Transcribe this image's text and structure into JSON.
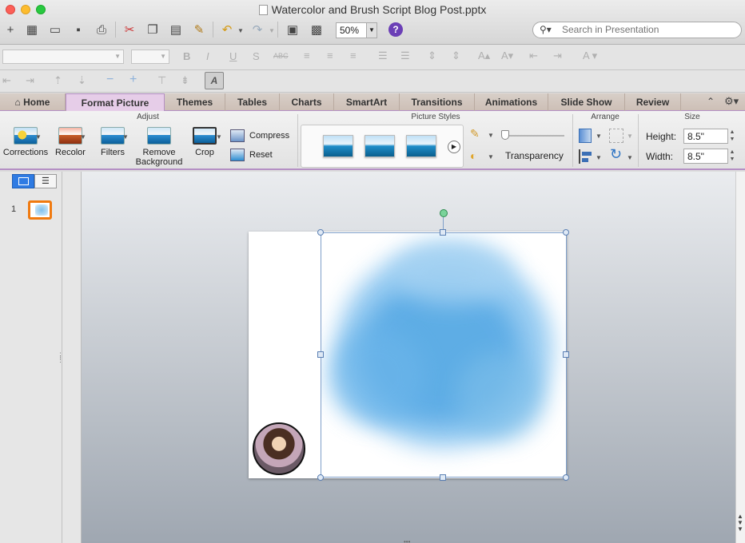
{
  "window": {
    "title": "Watercolor and Brush Script Blog Post.pptx"
  },
  "toolbar": {
    "zoom": "50%",
    "search_placeholder": "Search in Presentation"
  },
  "tabs": [
    {
      "label": "Home"
    },
    {
      "label": "Format Picture"
    },
    {
      "label": "Themes"
    },
    {
      "label": "Tables"
    },
    {
      "label": "Charts"
    },
    {
      "label": "SmartArt"
    },
    {
      "label": "Transitions"
    },
    {
      "label": "Animations"
    },
    {
      "label": "Slide Show"
    },
    {
      "label": "Review"
    }
  ],
  "ribbon": {
    "adjust": {
      "label": "Adjust",
      "corrections": "Corrections",
      "recolor": "Recolor",
      "filters": "Filters",
      "remove_bg_line1": "Remove",
      "remove_bg_line2": "Background",
      "crop": "Crop",
      "compress": "Compress",
      "reset": "Reset"
    },
    "picture_styles": {
      "label": "Picture Styles",
      "transparency": "Transparency"
    },
    "arrange": {
      "label": "Arrange"
    },
    "size": {
      "label": "Size",
      "height_label": "Height:",
      "height_value": "8.5\"",
      "width_label": "Width:",
      "width_value": "8.5\""
    }
  },
  "slides_pane": {
    "slide_number": "1"
  },
  "colors": {
    "accent": "#b58fc4",
    "active_tab": "#e6cde8",
    "selected_thumb": "#f07a10",
    "watercolor": "#5aa9e6"
  }
}
